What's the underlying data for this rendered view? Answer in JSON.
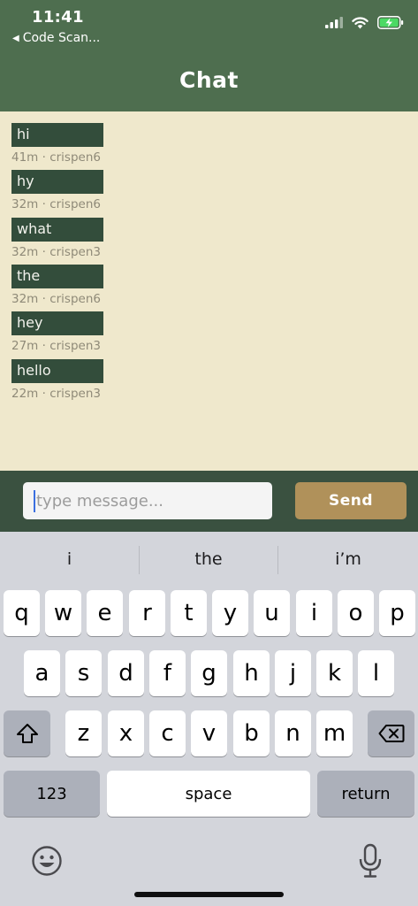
{
  "status_bar": {
    "time": "11:41",
    "back_label": "Code Scan..."
  },
  "header": {
    "title": "Chat"
  },
  "messages": [
    {
      "text": "hi",
      "meta": "41m · crispen6"
    },
    {
      "text": "hy",
      "meta": "32m · crispen6"
    },
    {
      "text": "what",
      "meta": "32m · crispen3"
    },
    {
      "text": "the",
      "meta": "32m · crispen6"
    },
    {
      "text": "hey",
      "meta": "27m · crispen3"
    },
    {
      "text": "hello",
      "meta": "22m · crispen3"
    }
  ],
  "composer": {
    "placeholder": "type message...",
    "send_label": "Send"
  },
  "keyboard": {
    "suggestions": [
      "i",
      "the",
      "i’m"
    ],
    "row1": [
      "q",
      "w",
      "e",
      "r",
      "t",
      "y",
      "u",
      "i",
      "o",
      "p"
    ],
    "row2": [
      "a",
      "s",
      "d",
      "f",
      "g",
      "h",
      "j",
      "k",
      "l"
    ],
    "row3": [
      "z",
      "x",
      "c",
      "v",
      "b",
      "n",
      "m"
    ],
    "numbers_label": "123",
    "space_label": "space",
    "return_label": "return"
  },
  "colors": {
    "header_bg": "#4e6e4f",
    "message_area_bg": "#efe8cc",
    "bubble_bg": "#334d3b",
    "input_bar_bg": "#3a5140",
    "send_button_bg": "#b0915a"
  }
}
